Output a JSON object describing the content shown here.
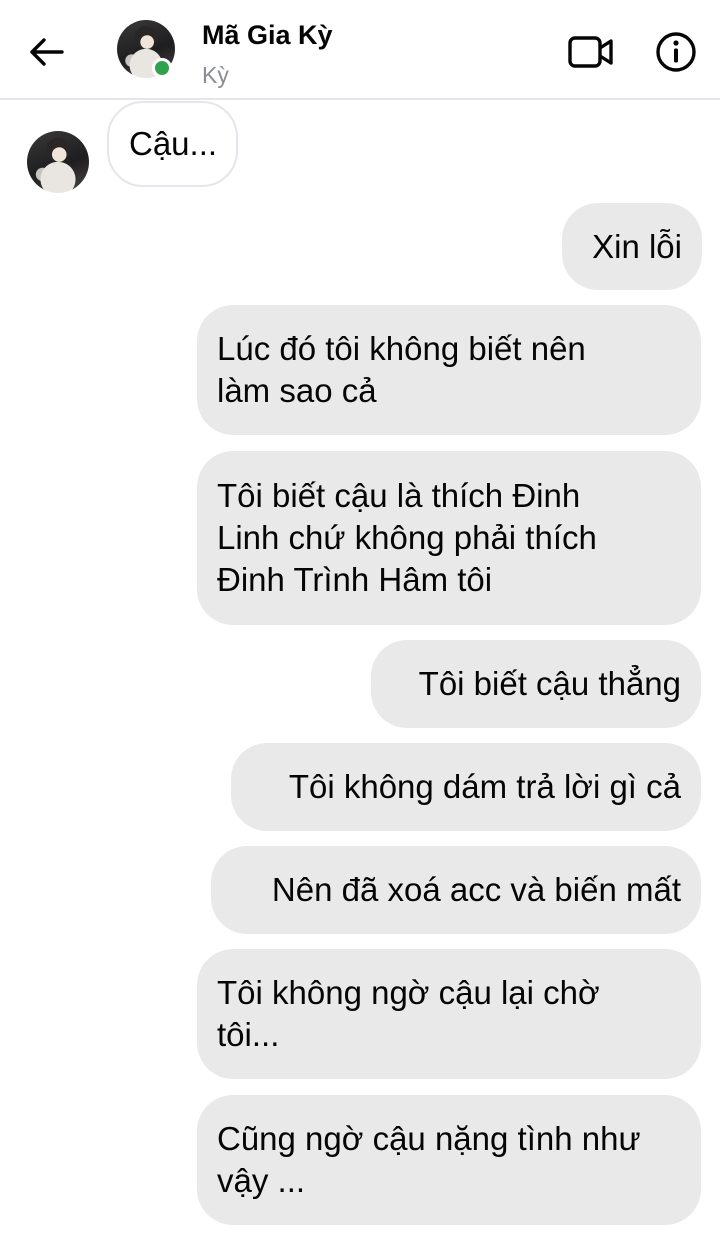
{
  "header": {
    "contact_name": "Mã Gia Kỳ",
    "contact_subtitle": "Kỳ",
    "online_color": "#31a24c"
  },
  "icons": {
    "back": "arrow-left",
    "video": "video-camera",
    "info": "info-circle"
  },
  "messages": [
    {
      "direction": "incoming",
      "text": "Cậu..."
    },
    {
      "direction": "outgoing",
      "text": "Xin lỗi"
    },
    {
      "direction": "outgoing",
      "text": "Lúc đó tôi không biết nên\nlàm sao cả"
    },
    {
      "direction": "outgoing",
      "text": "Tôi biết cậu là thích Đinh\nLinh chứ không phải thích\nĐinh Trình Hâm tôi"
    },
    {
      "direction": "outgoing",
      "text": "Tôi biết cậu thẳng"
    },
    {
      "direction": "outgoing",
      "text": "Tôi không dám trả lời gì cả"
    },
    {
      "direction": "outgoing",
      "text": "Nên đã xoá acc và biến mất"
    },
    {
      "direction": "outgoing",
      "text": "Tôi không ngờ cậu lại chờ\ntôi..."
    },
    {
      "direction": "outgoing",
      "text": "Cũng ngờ cậu nặng tình như\nvậy ..."
    }
  ]
}
